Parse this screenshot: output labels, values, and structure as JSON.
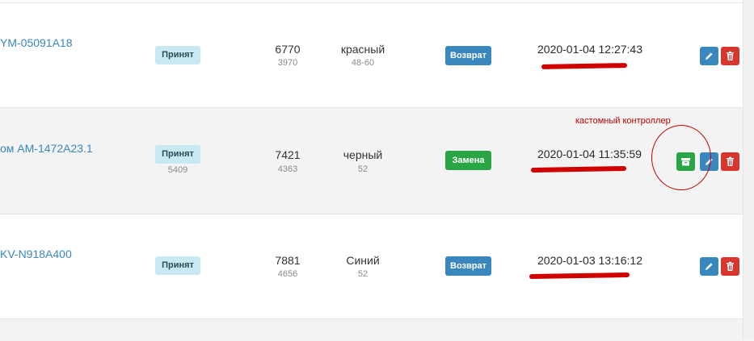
{
  "rows": [
    {
      "model": "YM-05091A18",
      "status": "Принят",
      "status_sub": "",
      "num": "6770",
      "num_sub": "3970",
      "color": "красный",
      "size": "48-60",
      "type": "Возврат",
      "datetime": "2020-01-04 12:27:43"
    },
    {
      "model": "ом AM-1472A23.1",
      "status": "Принят",
      "status_sub": "5409",
      "num": "7421",
      "num_sub": "4363",
      "color": "черный",
      "size": "52",
      "type": "Замена",
      "datetime": "2020-01-04 11:35:59"
    },
    {
      "model": "KV-N918A400",
      "status": "Принят",
      "status_sub": "",
      "num": "7881",
      "num_sub": "4656",
      "color": "Синий",
      "size": "52",
      "type": "Возврат",
      "datetime": "2020-01-03 13:16:12"
    }
  ],
  "annotation": "кастомный контроллер",
  "colors": {
    "link": "#3a87c0",
    "badge_bg": "#c8e9f2",
    "blue_button": "#3a87c0",
    "green_button": "#2aa545",
    "red_button": "#d6362e",
    "annotation_red": "#c00000"
  },
  "icons": {
    "edit": "pencil-icon",
    "delete": "trash-icon",
    "custom": "archive-icon"
  }
}
